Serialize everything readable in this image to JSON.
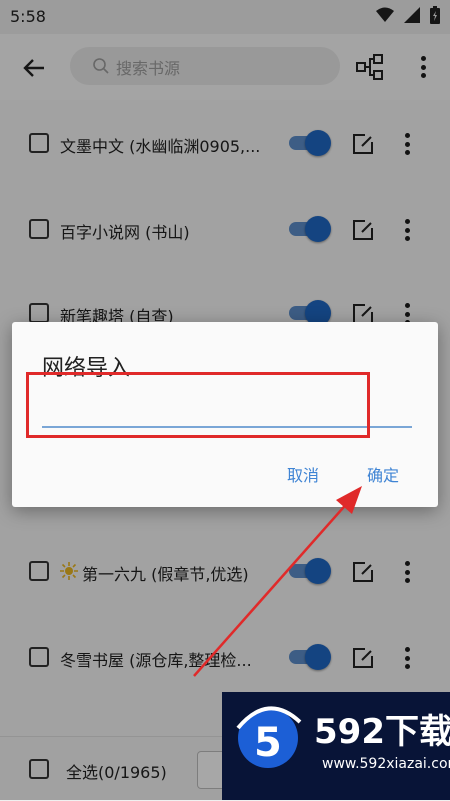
{
  "status_bar": {
    "time": "5:58"
  },
  "app_bar": {
    "search_placeholder": "搜索书源"
  },
  "list": {
    "items": [
      {
        "name": "文墨中文 (水幽临渊0905,...",
        "enabled": true
      },
      {
        "name": "百字小说网 (书山)",
        "enabled": true
      },
      {
        "name": "新笔趣塔 (自查)",
        "enabled": true
      },
      {
        "name": "",
        "enabled": true
      },
      {
        "name": "",
        "enabled": true
      },
      {
        "name": "第一六九 (假章节,优选)",
        "enabled": true,
        "has_star_icon": true
      },
      {
        "name": "冬雪书屋 (源仓库,整理检...",
        "enabled": true
      }
    ]
  },
  "bottom_bar": {
    "select_all_label": "全选(0/1965)"
  },
  "dialog": {
    "title": "网络导入",
    "input_value": "",
    "cancel_label": "取消",
    "confirm_label": "确定"
  },
  "watermark": {
    "brand": "592下载",
    "url": "www.592xiazai.com",
    "logo_digit": "5"
  },
  "colors": {
    "accent": "#1f66c1",
    "annotation_red": "#e02a2a",
    "dialog_button": "#3f84d4"
  }
}
